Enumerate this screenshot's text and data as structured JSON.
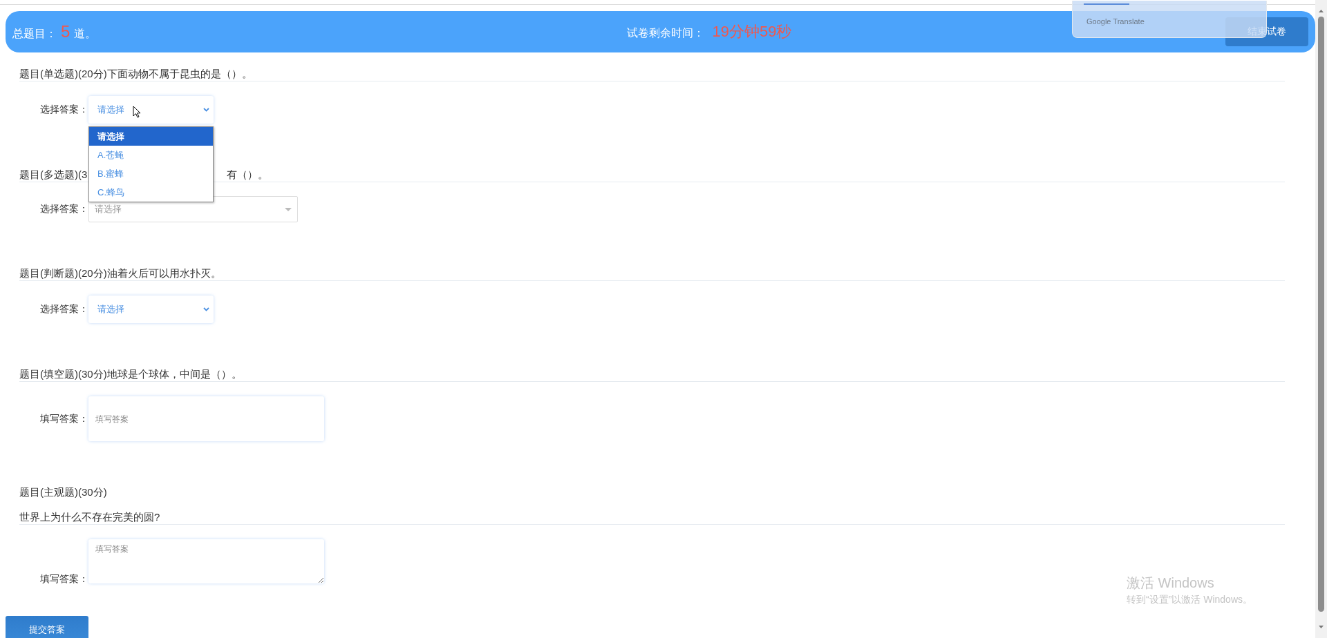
{
  "header": {
    "total_label": "总题目：",
    "total_count": "5",
    "total_unit": "道。",
    "timer_label": "试卷剩余时间：",
    "timer_value": "19分钟59秒",
    "end_button": "结束试卷"
  },
  "translate_popup": {
    "brand": "Google Translate"
  },
  "questions": [
    {
      "kind": "select",
      "title_parts": [
        "题目(单选题)(20分)下面动物不属于昆虫的是（）。"
      ],
      "answer_label": "选择答案：",
      "value": "请选择",
      "open": true,
      "options": [
        {
          "label": "请选择",
          "selected": true
        },
        {
          "label": "A.苍蝇",
          "selected": false
        },
        {
          "label": "B.蜜蜂",
          "selected": false
        },
        {
          "label": "C.蜂鸟",
          "selected": false
        }
      ]
    },
    {
      "kind": "multiselect",
      "title_parts": [
        "题目(多选题)(3",
        "有（）。"
      ],
      "answer_label": "选择答案：",
      "placeholder": "请选择"
    },
    {
      "kind": "select",
      "title_parts": [
        "题目(判断题)(20分)油着火后可以用水扑灭。"
      ],
      "answer_label": "选择答案：",
      "value": "请选择",
      "open": false
    },
    {
      "kind": "input",
      "title_parts": [
        "题目(填空题)(30分)地球是个球体，中间是（）。"
      ],
      "answer_label": "填写答案：",
      "placeholder": "填写答案"
    },
    {
      "kind": "textarea",
      "title_parts": [
        "题目(主观题)(30分)"
      ],
      "prompt": "世界上为什么不存在完美的圆?",
      "answer_label": "填写答案：",
      "placeholder": "填写答案"
    }
  ],
  "submit_button": "提交答案",
  "os_watermark": {
    "title": "激活 Windows",
    "subtitle": "转到“设置”以激活 Windows。"
  }
}
